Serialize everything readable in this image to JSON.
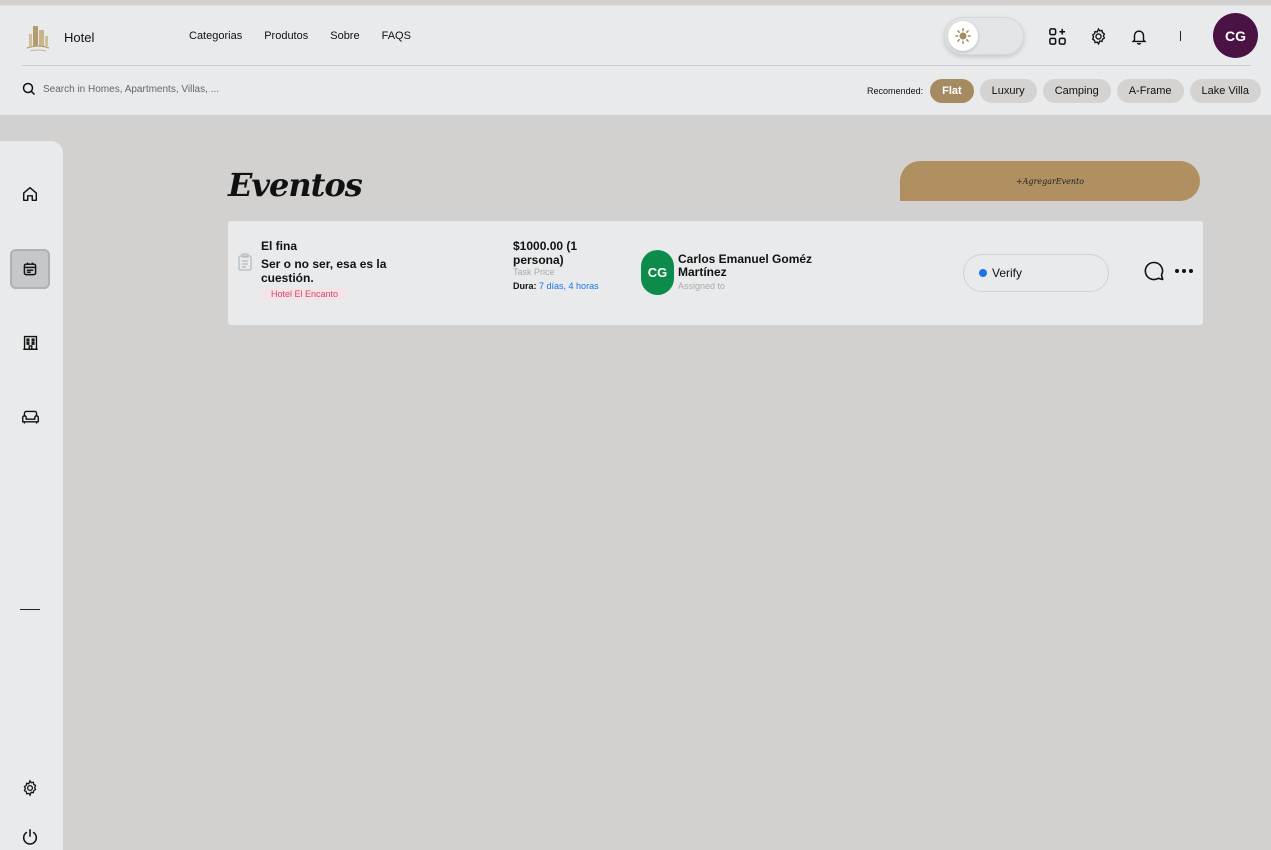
{
  "header": {
    "brand_name": "Hotel",
    "nav": [
      "Categorias",
      "Produtos",
      "Sobre",
      "FAQS"
    ],
    "separator": "I",
    "user_initials": "CG",
    "search_placeholder": "Search in Homes, Apartments, Villas, ...",
    "recommended_label": "Recomended:",
    "chips": [
      {
        "label": "Flat",
        "active": true
      },
      {
        "label": "Luxury",
        "active": false
      },
      {
        "label": "Camping",
        "active": false
      },
      {
        "label": "A-Frame",
        "active": false
      },
      {
        "label": "Lake Villa",
        "active": false
      }
    ]
  },
  "sidebar": {
    "items": [
      {
        "icon": "home-icon",
        "active": false
      },
      {
        "icon": "calendar-icon",
        "active": true
      },
      {
        "icon": "building-icon",
        "active": false
      },
      {
        "icon": "sofa-icon",
        "active": false
      },
      {
        "icon": "gear-icon",
        "active": false
      },
      {
        "icon": "power-icon",
        "active": false
      }
    ]
  },
  "main": {
    "title": "Eventos",
    "add_button": "+AgregarEvento",
    "events": [
      {
        "title": "El fina",
        "description": "Ser o no ser, esa es la cuestión.",
        "hotel": "Hotel El Encanto",
        "price": "$1000.00 (1 persona)",
        "price_label": "Task Price",
        "duration_label": "Dura:",
        "duration_value": "7 días, 4 horas",
        "assignee_initials": "CG",
        "assignee_name": "Carlos Emanuel Goméz Martínez",
        "assignee_label": "Assigned to",
        "status": "Verify"
      }
    ]
  },
  "colors": {
    "accent": "#a58b62",
    "add_button": "#b09060",
    "avatar_top": "#4a1343",
    "assignee_avatar": "#0c8b4a",
    "status_dot": "#1a73e8",
    "background": "#d2d1cf",
    "panel": "#e8eaeb"
  }
}
